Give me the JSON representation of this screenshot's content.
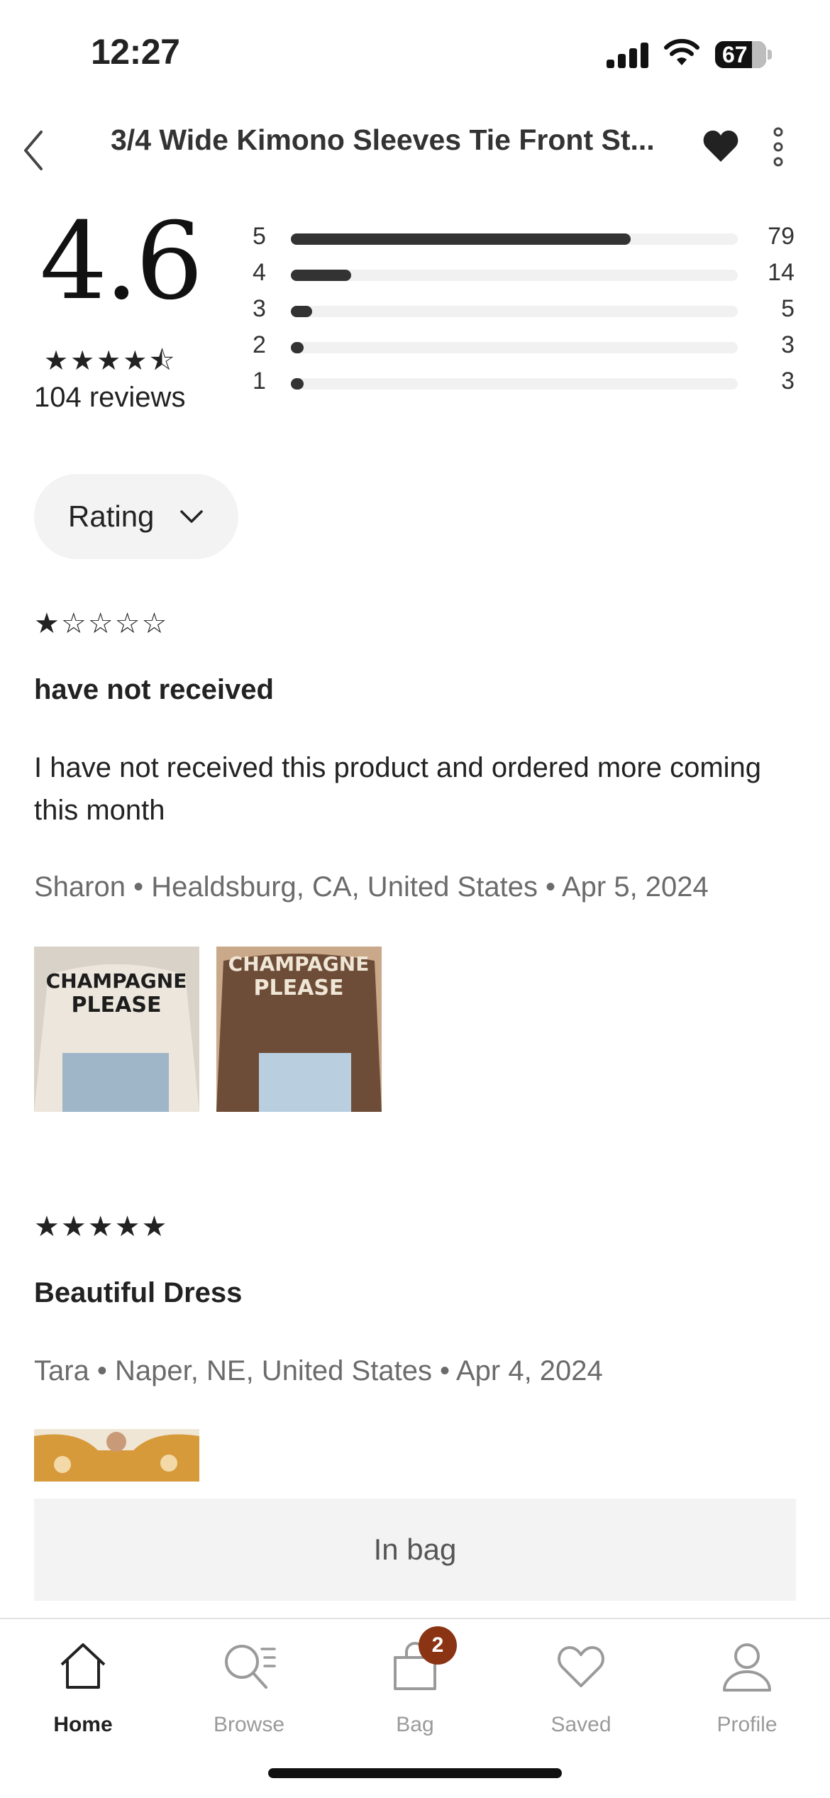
{
  "status_bar": {
    "time": "12:27",
    "battery": "67"
  },
  "header": {
    "title": "3/4 Wide Kimono Sleeves Tie Front St..."
  },
  "summary": {
    "average": "4.6",
    "average_stars": "★★★★⯪",
    "review_count": "104 reviews",
    "distribution": [
      {
        "stars": "5",
        "count": "79",
        "fraction": 0.76
      },
      {
        "stars": "4",
        "count": "14",
        "fraction": 0.135
      },
      {
        "stars": "3",
        "count": "5",
        "fraction": 0.048
      },
      {
        "stars": "2",
        "count": "3",
        "fraction": 0.029
      },
      {
        "stars": "1",
        "count": "3",
        "fraction": 0.029
      }
    ]
  },
  "filter": {
    "label": "Rating"
  },
  "reviews": [
    {
      "stars": "★☆☆☆☆",
      "rating": 1,
      "title": "have not received",
      "body": "I have not received this product and ordered more coming this month",
      "meta": "Sharon • Healdsburg, CA, United States • Apr 5, 2024",
      "photos": [
        {
          "text_top": "CHAMPAGNE",
          "text_bottom": "PLEASE",
          "sweater_color": "#ece6dc",
          "text_color": "#1d1d1d"
        },
        {
          "text_top": "CHAMPAGNE",
          "text_bottom": "PLEASE",
          "sweater_color": "#6e4d38",
          "text_color": "#efe6d6"
        }
      ]
    },
    {
      "stars": "★★★★★",
      "rating": 5,
      "title": "Beautiful Dress",
      "meta": "Tara • Naper, NE, United States • Apr 4, 2024"
    }
  ],
  "bag_button": {
    "label": "In bag"
  },
  "tabbar": {
    "items": [
      {
        "label": "Home",
        "icon": "home-icon",
        "active": true
      },
      {
        "label": "Browse",
        "icon": "browse-icon",
        "active": false
      },
      {
        "label": "Bag",
        "icon": "bag-icon",
        "active": false
      },
      {
        "label": "Saved",
        "icon": "heart-icon",
        "active": false
      },
      {
        "label": "Profile",
        "icon": "profile-icon",
        "active": false
      }
    ],
    "bag_badge": "2"
  },
  "colors": {
    "accent_badge": "#8a3414",
    "bar_fill": "#333333",
    "bar_track": "#f1f1f1"
  }
}
